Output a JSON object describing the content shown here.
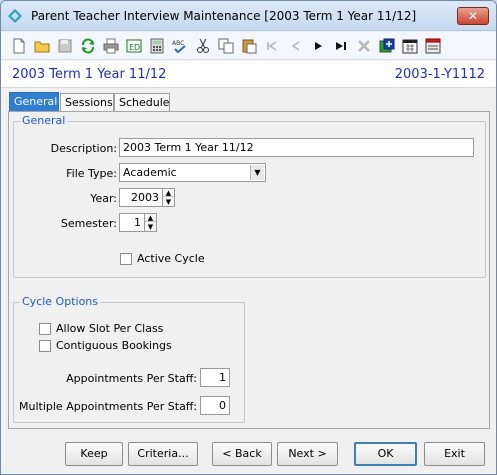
{
  "window": {
    "title": "Parent Teacher Interview Maintenance  [2003 Term 1 Year 11/12]",
    "close_label": "✕"
  },
  "toolbar": {
    "icons": [
      "new-icon",
      "open-icon",
      "save-icon",
      "refresh-icon",
      "print-icon",
      "edit-icon",
      "calculator-icon",
      "spellcheck-icon",
      "cut-icon",
      "copy-icon",
      "paste-icon",
      "first-record-icon",
      "previous-record-icon",
      "next-record-icon",
      "last-record-icon",
      "delete-icon",
      "add-record-icon",
      "calendar-icon",
      "schedule-icon"
    ]
  },
  "header": {
    "left": "2003 Term 1 Year 11/12",
    "right": "2003-1-Y1112"
  },
  "tabs": [
    {
      "label": "General",
      "active": true
    },
    {
      "label": "Sessions",
      "active": false
    },
    {
      "label": "Schedule",
      "active": false
    }
  ],
  "general": {
    "legend": "General",
    "description_label": "Description:",
    "description_value": "2003 Term 1 Year 11/12",
    "file_type_label": "File Type:",
    "file_type_value": "Academic",
    "year_label": "Year:",
    "year_value": "2003",
    "semester_label": "Semester:",
    "semester_value": "1",
    "active_cycle_label": "Active Cycle",
    "active_cycle_checked": false
  },
  "cycle_options": {
    "legend": "Cycle Options",
    "allow_slot_label": "Allow Slot Per Class",
    "allow_slot_checked": false,
    "contiguous_label": "Contiguous Bookings",
    "contiguous_checked": false,
    "appointments_label": "Appointments Per Staff:",
    "appointments_value": "1",
    "multiple_label": "Multiple Appointments Per Staff:",
    "multiple_value": "0"
  },
  "buttons": {
    "keep": "Keep",
    "criteria": "Criteria...",
    "back": "< Back",
    "next": "Next >",
    "ok": "OK",
    "exit": "Exit"
  },
  "colors": {
    "accent": "#1f2fb0",
    "tab_active": "#2f7fd1",
    "legend": "#1e5ac8"
  }
}
